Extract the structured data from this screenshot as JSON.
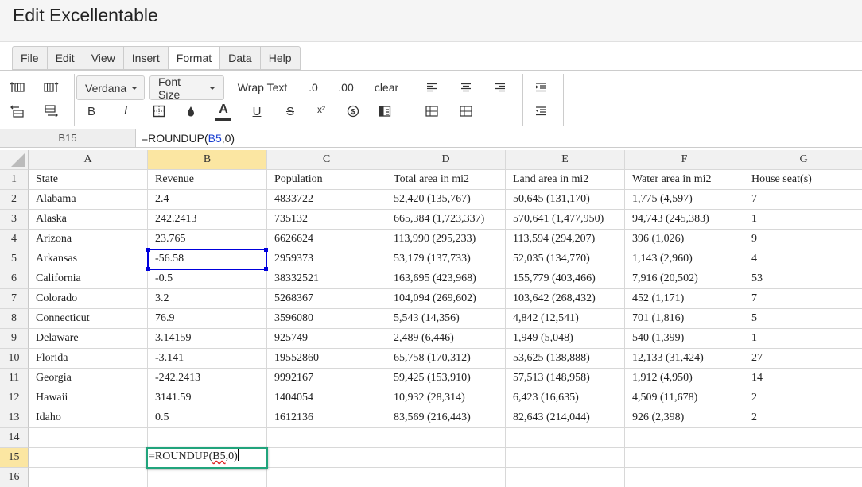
{
  "app": {
    "title": "Edit Excellentable"
  },
  "menu": [
    "File",
    "Edit",
    "View",
    "Insert",
    "Format",
    "Data",
    "Help"
  ],
  "menu_active": "Format",
  "toolbar": {
    "font_label": "Verdana",
    "font_size_label": "Font Size",
    "wrap_text": "Wrap Text",
    "decimal_decrease": ".0",
    "decimal_increase": ".00",
    "clear": "clear",
    "bold": "B",
    "italic": "I",
    "text_color": "A",
    "underline": "U",
    "strike": "S",
    "superscript": "x²",
    "currency": "$",
    "text_color_bar": "#333333"
  },
  "formula_bar": {
    "cell_ref": "B15",
    "formula_prefix": "=ROUNDUP(",
    "formula_ref": "B5",
    "formula_suffix": ",0)"
  },
  "columns": [
    "A",
    "B",
    "C",
    "D",
    "E",
    "F",
    "G"
  ],
  "selected_column": "B",
  "selected_row": "15",
  "rows": [
    {
      "n": "1",
      "cells": [
        "State",
        "Revenue",
        "Population",
        "Total area in mi2",
        "Land area in mi2",
        "Water area in mi2",
        "House seat(s)"
      ]
    },
    {
      "n": "2",
      "cells": [
        "Alabama",
        "2.4",
        "4833722",
        "52,420 (135,767)",
        "50,645 (131,170)",
        "1,775 (4,597)",
        "7"
      ]
    },
    {
      "n": "3",
      "cells": [
        "Alaska",
        "242.2413",
        "735132",
        "665,384 (1,723,337)",
        "570,641 (1,477,950)",
        "94,743 (245,383)",
        "1"
      ]
    },
    {
      "n": "4",
      "cells": [
        "Arizona",
        "23.765",
        "6626624",
        "113,990 (295,233)",
        "113,594 (294,207)",
        "396 (1,026)",
        "9"
      ]
    },
    {
      "n": "5",
      "cells": [
        "Arkansas",
        "-56.58",
        "2959373",
        "53,179 (137,733)",
        "52,035 (134,770)",
        "1,143 (2,960)",
        "4"
      ]
    },
    {
      "n": "6",
      "cells": [
        "California",
        "-0.5",
        "38332521",
        "163,695 (423,968)",
        "155,779 (403,466)",
        "7,916 (20,502)",
        "53"
      ]
    },
    {
      "n": "7",
      "cells": [
        "Colorado",
        "3.2",
        "5268367",
        "104,094 (269,602)",
        "103,642 (268,432)",
        "452 (1,171)",
        "7"
      ]
    },
    {
      "n": "8",
      "cells": [
        "Connecticut",
        "76.9",
        "3596080",
        "5,543 (14,356)",
        "4,842 (12,541)",
        "701 (1,816)",
        "5"
      ]
    },
    {
      "n": "9",
      "cells": [
        "Delaware",
        "3.14159",
        "925749",
        "2,489 (6,446)",
        "1,949 (5,048)",
        "540 (1,399)",
        "1"
      ]
    },
    {
      "n": "10",
      "cells": [
        "Florida",
        "-3.141",
        "19552860",
        "65,758 (170,312)",
        "53,625 (138,888)",
        "12,133 (31,424)",
        "27"
      ]
    },
    {
      "n": "11",
      "cells": [
        "Georgia",
        "-242.2413",
        "9992167",
        "59,425 (153,910)",
        "57,513 (148,958)",
        "1,912 (4,950)",
        "14"
      ]
    },
    {
      "n": "12",
      "cells": [
        "Hawaii",
        "3141.59",
        "1404054",
        "10,932 (28,314)",
        "6,423 (16,635)",
        "4,509 (11,678)",
        "2"
      ]
    },
    {
      "n": "13",
      "cells": [
        "Idaho",
        "0.5",
        "1612136",
        "83,569 (216,443)",
        "82,643 (214,044)",
        "926 (2,398)",
        "2"
      ]
    },
    {
      "n": "14",
      "cells": [
        "",
        "",
        "",
        "",
        "",
        "",
        ""
      ]
    },
    {
      "n": "15",
      "cells": [
        "",
        "",
        "",
        "",
        "",
        "",
        ""
      ]
    },
    {
      "n": "16",
      "cells": [
        "",
        "",
        "",
        "",
        "",
        "",
        ""
      ]
    }
  ],
  "editor": {
    "prefix": "=ROUNDUP(",
    "ref": "B5",
    "suffix": ",0)"
  }
}
